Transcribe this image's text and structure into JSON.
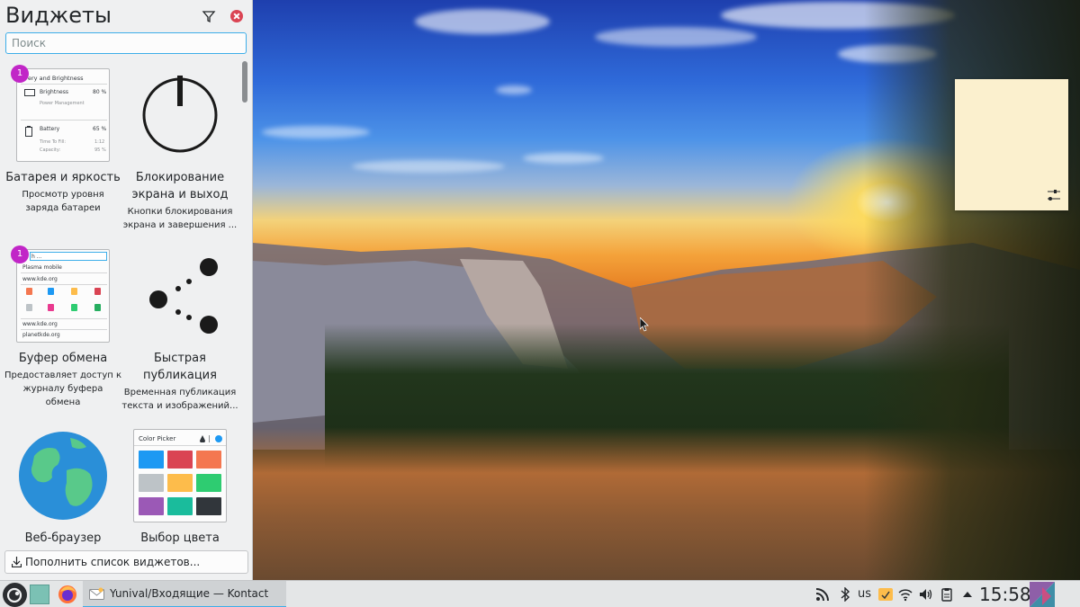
{
  "panel": {
    "title": "Виджеты",
    "search_placeholder": "Поиск",
    "more_widgets_label": "Пополнить список виджетов..."
  },
  "widgets": [
    {
      "name": "Батарея и яркость",
      "description": "Просмотр уровня заряда батареи",
      "count": "1",
      "preview": {
        "header": "ery and Brightness",
        "brightness_label": "Brightness",
        "brightness_value": "80 %",
        "power_management": "Power Management",
        "battery_label": "Battery",
        "battery_value": "65 %",
        "time_to_fill_label": "Time To Fill:",
        "time_to_fill_value": "1:12",
        "capacity_label": "Capacity:",
        "capacity_value": "95 %"
      }
    },
    {
      "name": "Блокирование экрана и выход",
      "description": "Кнопки блокирования экрана и завершения ...",
      "icon": "power-icon"
    },
    {
      "name": "Буфер обмена",
      "description": "Предоставляет доступ к журналу буфера обмена",
      "count": "1",
      "preview": {
        "search_text": "h ...",
        "row1": "Plasma mobile",
        "row2": "www.kde.org",
        "row3": "www.kde.org",
        "row4": "planetkde.org"
      }
    },
    {
      "name": "Быстрая публикация",
      "description": "Временная публикация текста и изображений...",
      "icon": "share-icon"
    },
    {
      "name": "Веб-браузер",
      "description": "",
      "icon": "globe-icon"
    },
    {
      "name": "Выбор цвета",
      "description": "",
      "preview": {
        "header": "Color Picker",
        "colors": [
          "#1d99f3",
          "#da4453",
          "#f47750",
          "#bdc3c7",
          "#fdbc4b",
          "#2ecc71",
          "#9b59b6",
          "#1abc9c",
          "#31363b"
        ]
      }
    }
  ],
  "taskbar": {
    "active_task": "Yunival/Входящие — Kontact",
    "keyboard_layout": "us",
    "clock": "15:58"
  },
  "colors": {
    "accent": "#3daee9",
    "close": "#da4453",
    "badge": "#c126c7",
    "sticky_note": "#fbf0ce"
  }
}
